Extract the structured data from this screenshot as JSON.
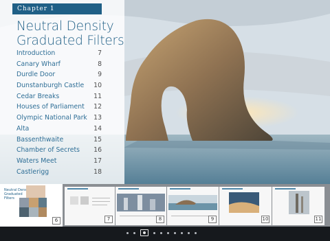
{
  "chapter_label": "Chapter 1",
  "title_line1": "Neutral Density",
  "title_line2": "Graduated Filters",
  "toc": [
    {
      "label": "Introduction",
      "page": "7"
    },
    {
      "label": "Canary Wharf",
      "page": "8"
    },
    {
      "label": "Durdle Door",
      "page": "9"
    },
    {
      "label": "Dunstanburgh Castle",
      "page": "10"
    },
    {
      "label": "Cedar Breaks",
      "page": "11"
    },
    {
      "label": "Houses of Parliament",
      "page": "12"
    },
    {
      "label": "Olympic National Park",
      "page": "13"
    },
    {
      "label": "Alta",
      "page": "14"
    },
    {
      "label": "Bassenthwaite",
      "page": "15"
    },
    {
      "label": "Chamber of Secrets",
      "page": "16"
    },
    {
      "label": "Waters Meet",
      "page": "17"
    },
    {
      "label": "Castlerigg",
      "page": "18"
    }
  ],
  "thumbnails": {
    "first": {
      "title1": "Neutral Density",
      "title2": "Graduated Filters",
      "page": "6"
    },
    "pages": [
      "7",
      "8",
      "9",
      "10",
      "11"
    ]
  },
  "pager": {
    "active_index": 3,
    "count": 12
  },
  "colors": {
    "accent": "#1f5f86",
    "toc_text": "#2e6e96"
  }
}
